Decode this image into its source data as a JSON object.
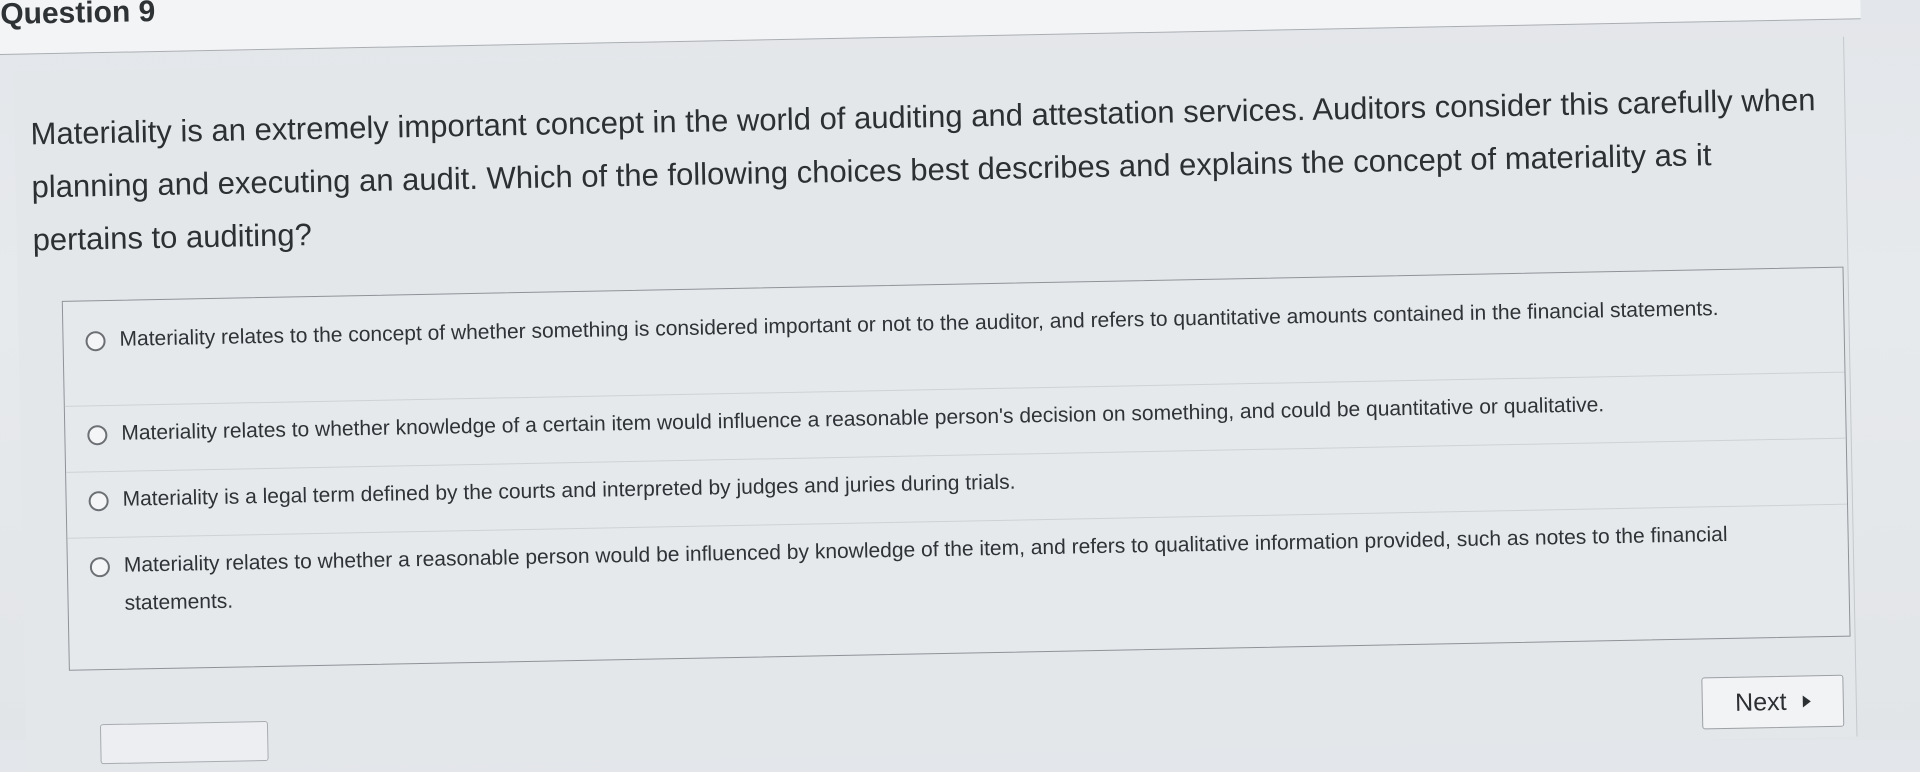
{
  "question": {
    "title": "Question 9",
    "prompt": "Materiality is an extremely important concept in the world of auditing and attestation services. Auditors consider this carefully when planning and executing an audit. Which of the following choices best describes and explains the concept of materiality as it pertains to auditing?"
  },
  "answers": [
    {
      "text": "Materiality relates to the concept of whether something is considered important or not to the auditor, and refers to quantitative amounts contained in the financial statements.",
      "selected": false
    },
    {
      "text": "Materiality relates to whether knowledge of a certain item would influence a reasonable person's decision on something, and could be quantitative or qualitative.",
      "selected": false
    },
    {
      "text": "Materiality is a legal term defined by the courts and interpreted by judges and juries during trials.",
      "selected": false
    },
    {
      "text": "Materiality relates to whether a reasonable person would be influenced by knowledge of the item, and refers to qualitative information provided, such as notes to the financial statements.",
      "selected": false
    }
  ],
  "navigation": {
    "next_label": "Next",
    "next_icon": "play-arrow-icon"
  }
}
